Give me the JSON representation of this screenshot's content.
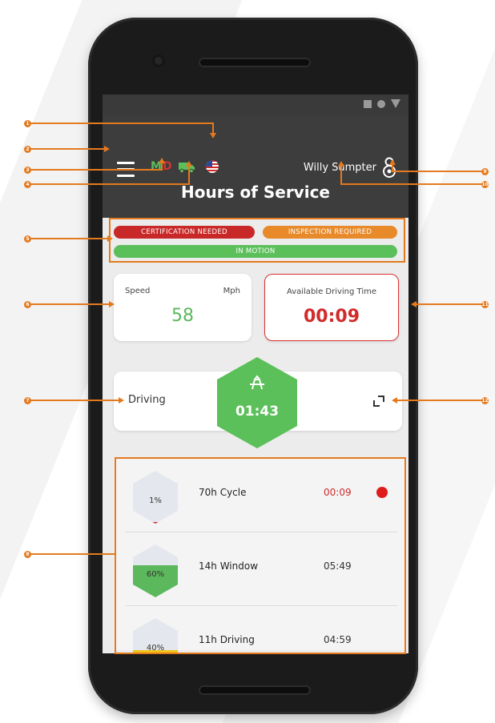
{
  "colors": {
    "accent_orange": "#e47a1e",
    "appbar": "#3d3d3d",
    "green": "#5cc05a",
    "red": "#c92828",
    "orange": "#e88a2a"
  },
  "appbar": {
    "logo": {
      "m": "M",
      "d": "D"
    },
    "user_name": "Willy Sumpter",
    "title": "Hours of Service"
  },
  "badges": {
    "certification": "CERTIFICATION NEEDED",
    "inspection": "INSPECTION REQUIRED",
    "motion": "IN MOTION"
  },
  "speed": {
    "label": "Speed",
    "unit": "Mph",
    "value": "58"
  },
  "available_driving": {
    "label": "Available Driving Time",
    "value": "00:09"
  },
  "status": {
    "label": "Driving",
    "time": "01:43"
  },
  "timers": [
    {
      "percent": "1%",
      "name": "70h Cycle",
      "value": "00:09",
      "fill": 0.01,
      "fill_color": "#d12b2b",
      "alert": true
    },
    {
      "percent": "60%",
      "name": "14h Window",
      "value": "05:49",
      "fill": 0.6,
      "fill_color": "#5cb85c",
      "alert": false
    },
    {
      "percent": "40%",
      "name": "11h Driving",
      "value": "04:59",
      "fill": 0.4,
      "fill_color": "#f0c419",
      "alert": false
    }
  ],
  "annotations": [
    "1",
    "2",
    "3",
    "4",
    "5",
    "6",
    "7",
    "8",
    "9",
    "10",
    "11",
    "12"
  ],
  "icons": [
    "menu-icon",
    "truck-icon",
    "us-flag-icon",
    "user-icon",
    "steering-wheel-icon",
    "expand-icon",
    "status-bar-square",
    "status-bar-circle",
    "status-bar-triangle"
  ]
}
